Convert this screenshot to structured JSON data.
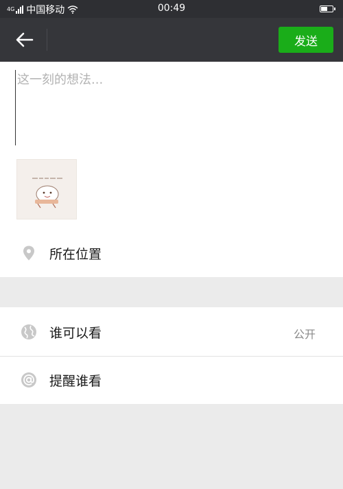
{
  "status_bar": {
    "network_badge": "4G",
    "carrier": "中国移动",
    "time": "00:49",
    "battery_level": 0.55
  },
  "nav": {
    "send_label": "发送"
  },
  "composer": {
    "placeholder": "这一刻的想法..."
  },
  "options": {
    "location_label": "所在位置",
    "visibility_label": "谁可以看",
    "visibility_value": "公开",
    "mention_label": "提醒谁看"
  },
  "icons": {
    "back": "arrow-left-icon",
    "location": "location-pin-icon",
    "visibility": "globe-icon",
    "mention": "at-icon"
  },
  "colors": {
    "accent": "#1aad19",
    "bar_bg": "#35363a",
    "section_gray": "#ebebeb",
    "icon_gray": "#c8c8c8"
  }
}
